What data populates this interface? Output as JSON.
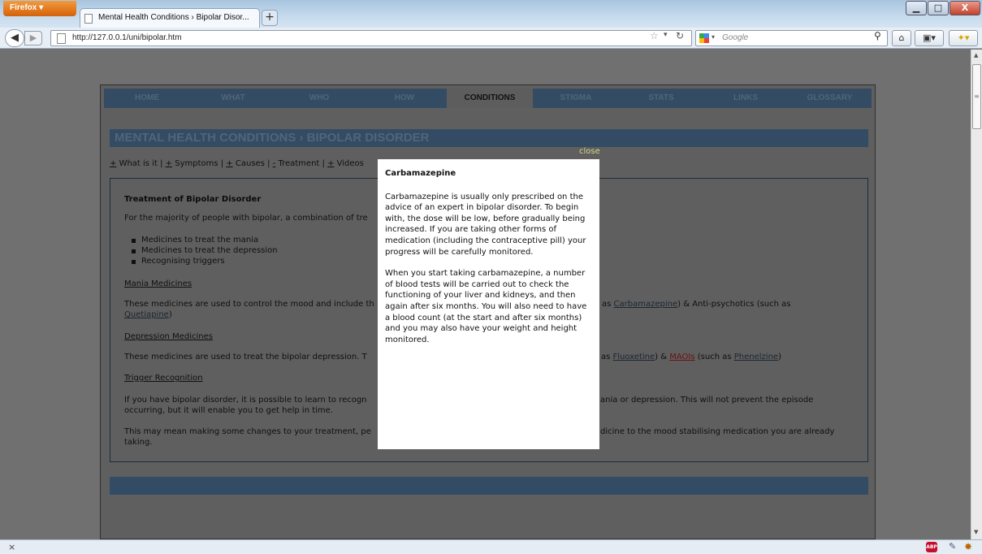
{
  "browser": {
    "menu_button": "Firefox",
    "tab_title": "Mental Health Conditions › Bipolar Disor...",
    "new_tab": "+",
    "url": "http://127.0.0.1/uni/bipolar.htm",
    "search_placeholder": "Google",
    "window_min": "▁",
    "window_max": "□",
    "window_close": "X",
    "status_close": "×"
  },
  "site": {
    "nav": [
      "HOME",
      "WHAT",
      "WHO",
      "HOW",
      "CONDITIONS",
      "STIGMA",
      "STATS",
      "LINKS",
      "GLOSSARY"
    ],
    "active_nav": "CONDITIONS",
    "section_title": "MENTAL HEALTH CONDITIONS › BIPOLAR DISORDER",
    "subnav": [
      {
        "sign": "+",
        "label": "What is it"
      },
      {
        "sign": "+",
        "label": "Symptoms"
      },
      {
        "sign": "+",
        "label": "Causes"
      },
      {
        "sign": "-",
        "label": "Treatment"
      },
      {
        "sign": "+",
        "label": "Videos"
      }
    ],
    "content": {
      "heading": "Treatment of Bipolar Disorder",
      "intro": "For the majority of people with bipolar, a combination of tre",
      "bullets": [
        "Medicines to treat the mania",
        "Medicines to treat the depression",
        "Recognising triggers"
      ],
      "mania_heading": "Mania Medicines",
      "mania_text_1": "These medicines are used to control the mood and include th",
      "mania_text_2": "ch as",
      "mania_link_1": "Carbamazepine",
      "mania_text_3": ") & Anti-psychotics (such as",
      "mania_link_2": "Quetiapine",
      "mania_text_4": ")",
      "depression_heading": "Depression Medicines",
      "depression_text_1": "These medicines are used to treat the bipolar depression. T",
      "depression_text_2": "as",
      "depression_link_1": "Fluoxetine",
      "depression_text_3": ") &",
      "depression_link_2": "MAOIs",
      "depression_text_4": "(such as",
      "depression_link_3": "Phenelzine",
      "depression_text_5": ")",
      "trigger_heading": "Trigger Recognition",
      "trigger_text_1a": "If you have bipolar disorder, it is possible to learn to recogn",
      "trigger_text_1b": "ania or depression. This will not prevent the episode",
      "trigger_text_2": "occurring, but it will enable you to get help in time.",
      "trigger_text_3a": "This may mean making some changes to your treatment, pe",
      "trigger_text_3b": "dicine to the mood stabilising medication you are already",
      "trigger_text_4": "taking."
    }
  },
  "popup": {
    "close_label": "close",
    "title": "Carbamazepine",
    "paragraph_1": "Carbamazepine is usually only prescribed on the advice of an expert in bipolar disorder. To begin with, the dose will be low, before gradually being increased. If you are taking other forms of medication (including the contraceptive pill) your progress will be carefully monitored.",
    "paragraph_2": "When you start taking carbamazepine, a number of blood tests will be carried out to check the functioning of your liver and kidneys, and then again after six months. You will also need to have a blood count (at the start and after six months) and you may also have your weight and height monitored."
  },
  "colors": {
    "overlay": "#707070",
    "nav_bar": "#334c63",
    "popup_bg": "#ffffff",
    "close_link": "#d9d78c"
  },
  "icons": [
    "page-icon",
    "back-arrow-icon",
    "forward-arrow-icon",
    "bookmark-star-icon",
    "reload-icon",
    "search-icon",
    "home-icon",
    "adblock-icon"
  ]
}
